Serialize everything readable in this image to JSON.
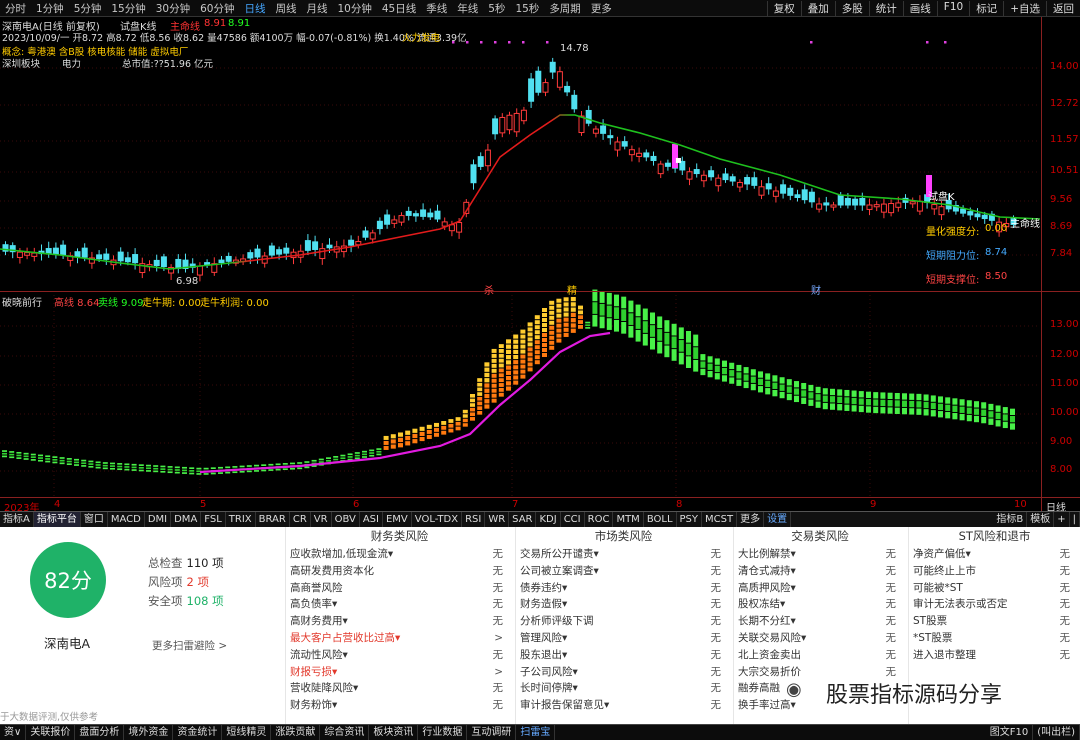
{
  "toolbar": {
    "periods": [
      "分时",
      "1分钟",
      "5分钟",
      "15分钟",
      "30分钟",
      "60分钟",
      "日线",
      "周线",
      "月线",
      "10分钟",
      "45日线",
      "季线",
      "年线",
      "5秒",
      "15秒",
      "多周期",
      "更多"
    ],
    "active_period": "日线",
    "right": [
      "复权",
      "叠加",
      "多股",
      "统计",
      "画线",
      "F10",
      "标记",
      "+自选",
      "返回"
    ]
  },
  "stock": {
    "name": "深南电A(日线 前复权)",
    "trial": "试盘K线",
    "main_label": "主命线",
    "val1": "8.91",
    "val2": "8.91",
    "info": "2023/10/09/一  开8.72 高8.72 低8.56 收8.62 量47586 额4100万 幅-0.07(-0.81%) 换1.40% 流通3.39亿",
    "fire": "火力发电",
    "concept": "概念: 粤港澳 含B股 核电核能 储能 虚拟电厂",
    "board": "深圳板块",
    "industry": "电力",
    "mktcap": "总市值:??51.96 亿元"
  },
  "chart": {
    "price_axis": [
      "14.00",
      "12.72",
      "11.57",
      "10.51",
      "9.56",
      "8.69",
      "7.84"
    ],
    "high_label": "14.78",
    "low_label": "6.98",
    "trial_k": "试盘K",
    "flag_s": "杀",
    "flag_b": "精",
    "flag_c": "财",
    "main_line_label": "主命线",
    "tags": [
      {
        "label": "量化强度分:",
        "value": "0.00"
      },
      {
        "label": "短期阻力位:",
        "value": "8.74"
      },
      {
        "label": "短期支撑位:",
        "value": "8.50"
      }
    ],
    "date_labels": [
      "2023年",
      "4",
      "5",
      "6",
      "7",
      "8",
      "9",
      "10"
    ],
    "day_label": "日线"
  },
  "indicator": {
    "name": "破晓前行",
    "line1": "高线 8.64",
    "line2": "卖线 9.09",
    "line3": "走牛期: 0.00",
    "line4": "走牛利润: 0.00",
    "axis": [
      "13.00",
      "12.00",
      "11.00",
      "10.00",
      "9.00",
      "8.00"
    ]
  },
  "tabs": {
    "items": [
      "指标A",
      "指标平台",
      "窗口",
      "MACD",
      "DMI",
      "DMA",
      "FSL",
      "TRIX",
      "BRAR",
      "CR",
      "VR",
      "OBV",
      "ASI",
      "EMV",
      "VOL-TDX",
      "RSI",
      "WR",
      "SAR",
      "KDJ",
      "CCI",
      "ROC",
      "MTM",
      "BOLL",
      "PSY",
      "MCST",
      "更多",
      "设置"
    ],
    "right": [
      "指标B",
      "模板",
      "+",
      "|"
    ]
  },
  "risk": {
    "score": "82分",
    "stock": "深南电A",
    "total_label": "总检查",
    "total": "110 项",
    "risk_label": "风险项",
    "risk": "2 项",
    "safe_label": "安全项",
    "safe": "108 项",
    "more": "更多扫雷避险 >",
    "footnote": "于大数据评测,仅供参考",
    "watermark": "股票指标源码分享",
    "columns": [
      {
        "title": "财务类风险",
        "rows": [
          [
            "应收款增加,低现金流▾",
            "无"
          ],
          [
            "高研发费用资本化",
            "无"
          ],
          [
            "高商誉风险",
            "无"
          ],
          [
            "高负债率▾",
            "无"
          ],
          [
            "高财务费用▾",
            "无"
          ],
          [
            "最大客户占营收比过高▾",
            ">"
          ],
          [
            "流动性风险▾",
            "无"
          ],
          [
            "财报亏损▾",
            ">"
          ],
          [
            "营收陡降风险▾",
            "无"
          ],
          [
            "财务粉饰▾",
            "无"
          ]
        ]
      },
      {
        "title": "市场类风险",
        "rows": [
          [
            "交易所公开谴责▾",
            "无"
          ],
          [
            "公司被立案调查▾",
            "无"
          ],
          [
            "债券违约▾",
            "无"
          ],
          [
            "财务造假▾",
            "无"
          ],
          [
            "分析师评级下调",
            "无"
          ],
          [
            "管理风险▾",
            "无"
          ],
          [
            "股东退出▾",
            "无"
          ],
          [
            "子公司风险▾",
            "无"
          ],
          [
            "长时间停牌▾",
            "无"
          ],
          [
            "审计报告保留意见▾",
            "无"
          ]
        ]
      },
      {
        "title": "交易类风险",
        "rows": [
          [
            "大比例解禁▾",
            "无"
          ],
          [
            "清仓式减持▾",
            "无"
          ],
          [
            "高质押风险▾",
            "无"
          ],
          [
            "股权冻结▾",
            "无"
          ],
          [
            "长期不分红▾",
            "无"
          ],
          [
            "关联交易风险▾",
            "无"
          ],
          [
            "北上资金卖出",
            "无"
          ],
          [
            "大宗交易折价",
            "无"
          ],
          [
            "融券高融",
            ""
          ],
          [
            "换手率过高▾",
            ""
          ]
        ]
      },
      {
        "title": "ST风险和退市",
        "rows": [
          [
            "净资产偏低▾",
            "无"
          ],
          [
            "可能终止上市",
            "无"
          ],
          [
            "可能被*ST",
            "无"
          ],
          [
            "审计无法表示或否定",
            "无"
          ],
          [
            "ST股票",
            "无"
          ],
          [
            "*ST股票",
            "无"
          ],
          [
            "进入退市整理",
            "无"
          ]
        ]
      }
    ]
  },
  "bottom": {
    "items": [
      "资∨",
      "关联报价",
      "盘面分析",
      "境外资金",
      "资金统计",
      "短线精灵",
      "涨跌贡献",
      "综合资讯",
      "板块资讯",
      "行业数据",
      "互动调研",
      "扫雷宝"
    ],
    "active": "扫雷宝",
    "right": "图文F10",
    "right2": "(叫出栏)"
  }
}
